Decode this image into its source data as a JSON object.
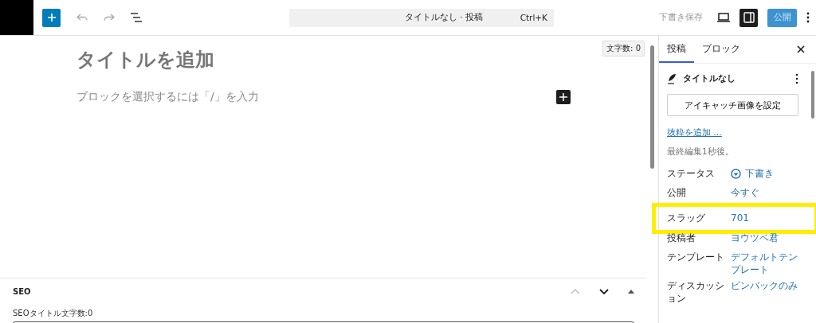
{
  "header": {
    "command": {
      "title": "タイトルなし · 投稿",
      "shortcut": "Ctrl+K"
    },
    "save_draft": "下書き保存",
    "sidebar_toggle": {
      "selected": true
    },
    "publish": "公開"
  },
  "editor": {
    "word_count": "文字数: 0",
    "title_placeholder": "タイトルを追加",
    "block_placeholder": "ブロックを選択するには「/」を入力"
  },
  "seo_panel": {
    "title": "SEO",
    "field_label": "SEOタイトル文字数:0"
  },
  "sidebar": {
    "tabs": [
      {
        "label": "投稿",
        "selected": true
      },
      {
        "label": "ブロック",
        "selected": false
      }
    ],
    "post_title": "タイトルなし",
    "featured_image_button": "アイキャッチ画像を設定",
    "excerpt_link": "抜粋を追加 …",
    "last_edited": "最終編集1秒後。",
    "rows": [
      {
        "label": "ステータス",
        "value": "下書き",
        "kind": "status",
        "highlighted": false
      },
      {
        "label": "公開",
        "value": "今すぐ",
        "kind": "link",
        "highlighted": false
      },
      {
        "label": "スラッグ",
        "value": "701",
        "kind": "link",
        "highlighted": true
      },
      {
        "label": "投稿者",
        "value": "ヨウツベ君",
        "kind": "link",
        "highlighted": false
      },
      {
        "label": "テンプレート",
        "value": "デフォルトテンプレート",
        "kind": "link",
        "highlighted": false
      },
      {
        "label": "ディスカッション",
        "value": "ピンバックのみ",
        "kind": "link",
        "highlighted": false
      }
    ]
  }
}
